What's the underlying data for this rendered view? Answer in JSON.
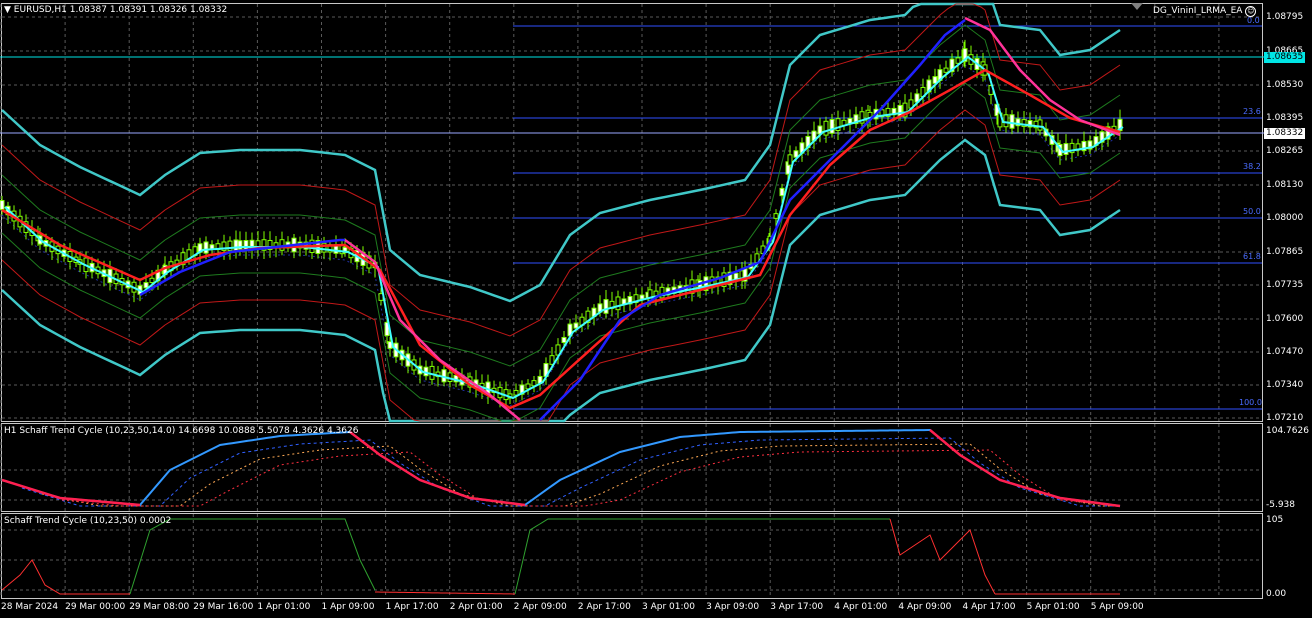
{
  "main": {
    "header": "EURUSD,H1  1.08387 1.08391 1.08326 1.08332",
    "ea_name": "DG_VininI_LRMA_EA",
    "ea_icon": "smiley-icon",
    "price_ticks": [
      "1.08795",
      "1.08665",
      "1.08530",
      "1.08395",
      "1.08265",
      "1.08130",
      "1.08000",
      "1.07865",
      "1.07735",
      "1.07600",
      "1.07470",
      "1.07340",
      "1.07210"
    ],
    "current_price": "1.08332",
    "hline_price": "1.08635",
    "fib_labels": [
      "0.0",
      "23.6",
      "38.2",
      "50.0",
      "61.8",
      "100.0"
    ],
    "colors": {
      "bull": "#7fff00",
      "cyan": "#00e5e5",
      "red": "#ff2020",
      "blue": "#2020ff",
      "pink": "#ff3399",
      "grid": "#5a5a5a"
    }
  },
  "stc1": {
    "header": "H1 Schaff Trend Cycle (10,23,50,14.0) 14.6698 10.0888 5.5078 4.3626 4.3626",
    "max": "104.7626",
    "min": "-5.938"
  },
  "stc2": {
    "header": "Schaff Trend Cycle (10,23,50) 0.0002",
    "max": "105",
    "min": "0.00"
  },
  "time_axis": [
    "28 Mar 2024",
    "29 Mar 00:00",
    "29 Mar 08:00",
    "29 Mar 16:00",
    "1 Apr 01:00",
    "1 Apr 09:00",
    "1 Apr 17:00",
    "2 Apr 01:00",
    "2 Apr 09:00",
    "2 Apr 17:00",
    "3 Apr 01:00",
    "3 Apr 09:00",
    "3 Apr 17:00",
    "4 Apr 01:00",
    "4 Apr 09:00",
    "4 Apr 17:00",
    "5 Apr 01:00",
    "5 Apr 09:00"
  ]
}
